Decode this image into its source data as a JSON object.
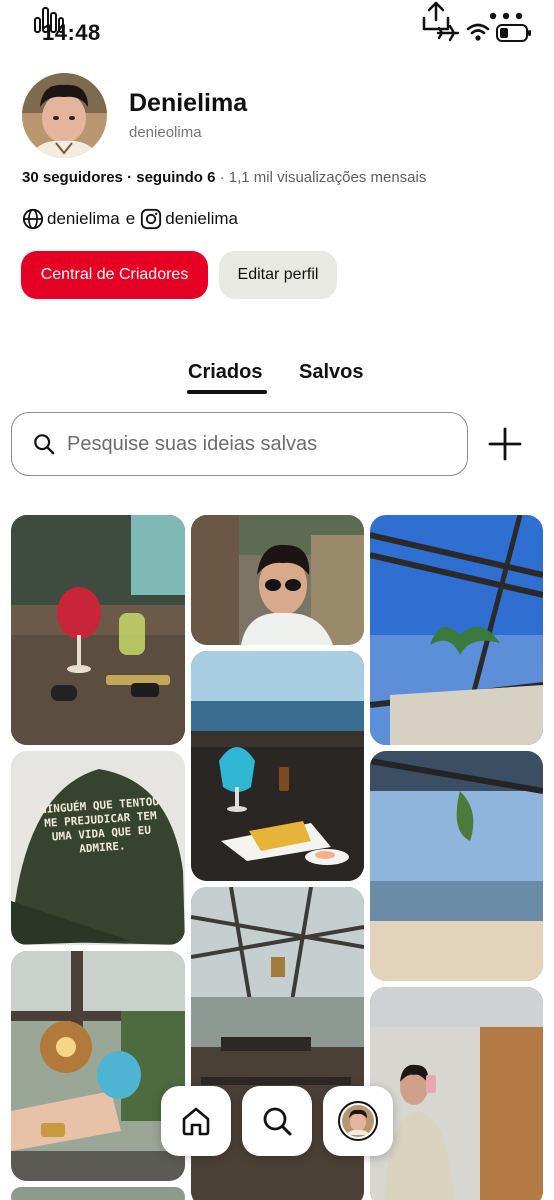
{
  "status_bar": {
    "time": "14:48"
  },
  "profile": {
    "name": "Denielima",
    "handle": "denieolima",
    "followers": "30 seguidores",
    "following": "seguindo 6",
    "monthly_views": "1,1 mil visualizações mensais",
    "website_link": "denielima",
    "links_joiner": "e",
    "instagram_link": "denielima"
  },
  "actions": {
    "creators_hub_label": "Central de Criadores",
    "edit_profile_label": "Editar perfil"
  },
  "tabs": [
    {
      "label": "Criados",
      "active": true
    },
    {
      "label": "Salvos",
      "active": false
    }
  ],
  "search": {
    "placeholder": "Pesquise suas ideias salvas"
  },
  "pins": {
    "cap_text_lines": [
      "NINGUÉM QUE TENTOU",
      "ME PREJUDICAR TEM",
      "UMA VIDA QUE EU",
      "ADMIRE."
    ]
  },
  "colors": {
    "accent": "#e60023",
    "secondary_button": "#e9e9e4"
  },
  "icons": {
    "website": "globe-icon",
    "instagram": "instagram-icon",
    "add": "plus-icon",
    "nav": [
      "home-icon",
      "search-icon",
      "profile-avatar"
    ]
  }
}
